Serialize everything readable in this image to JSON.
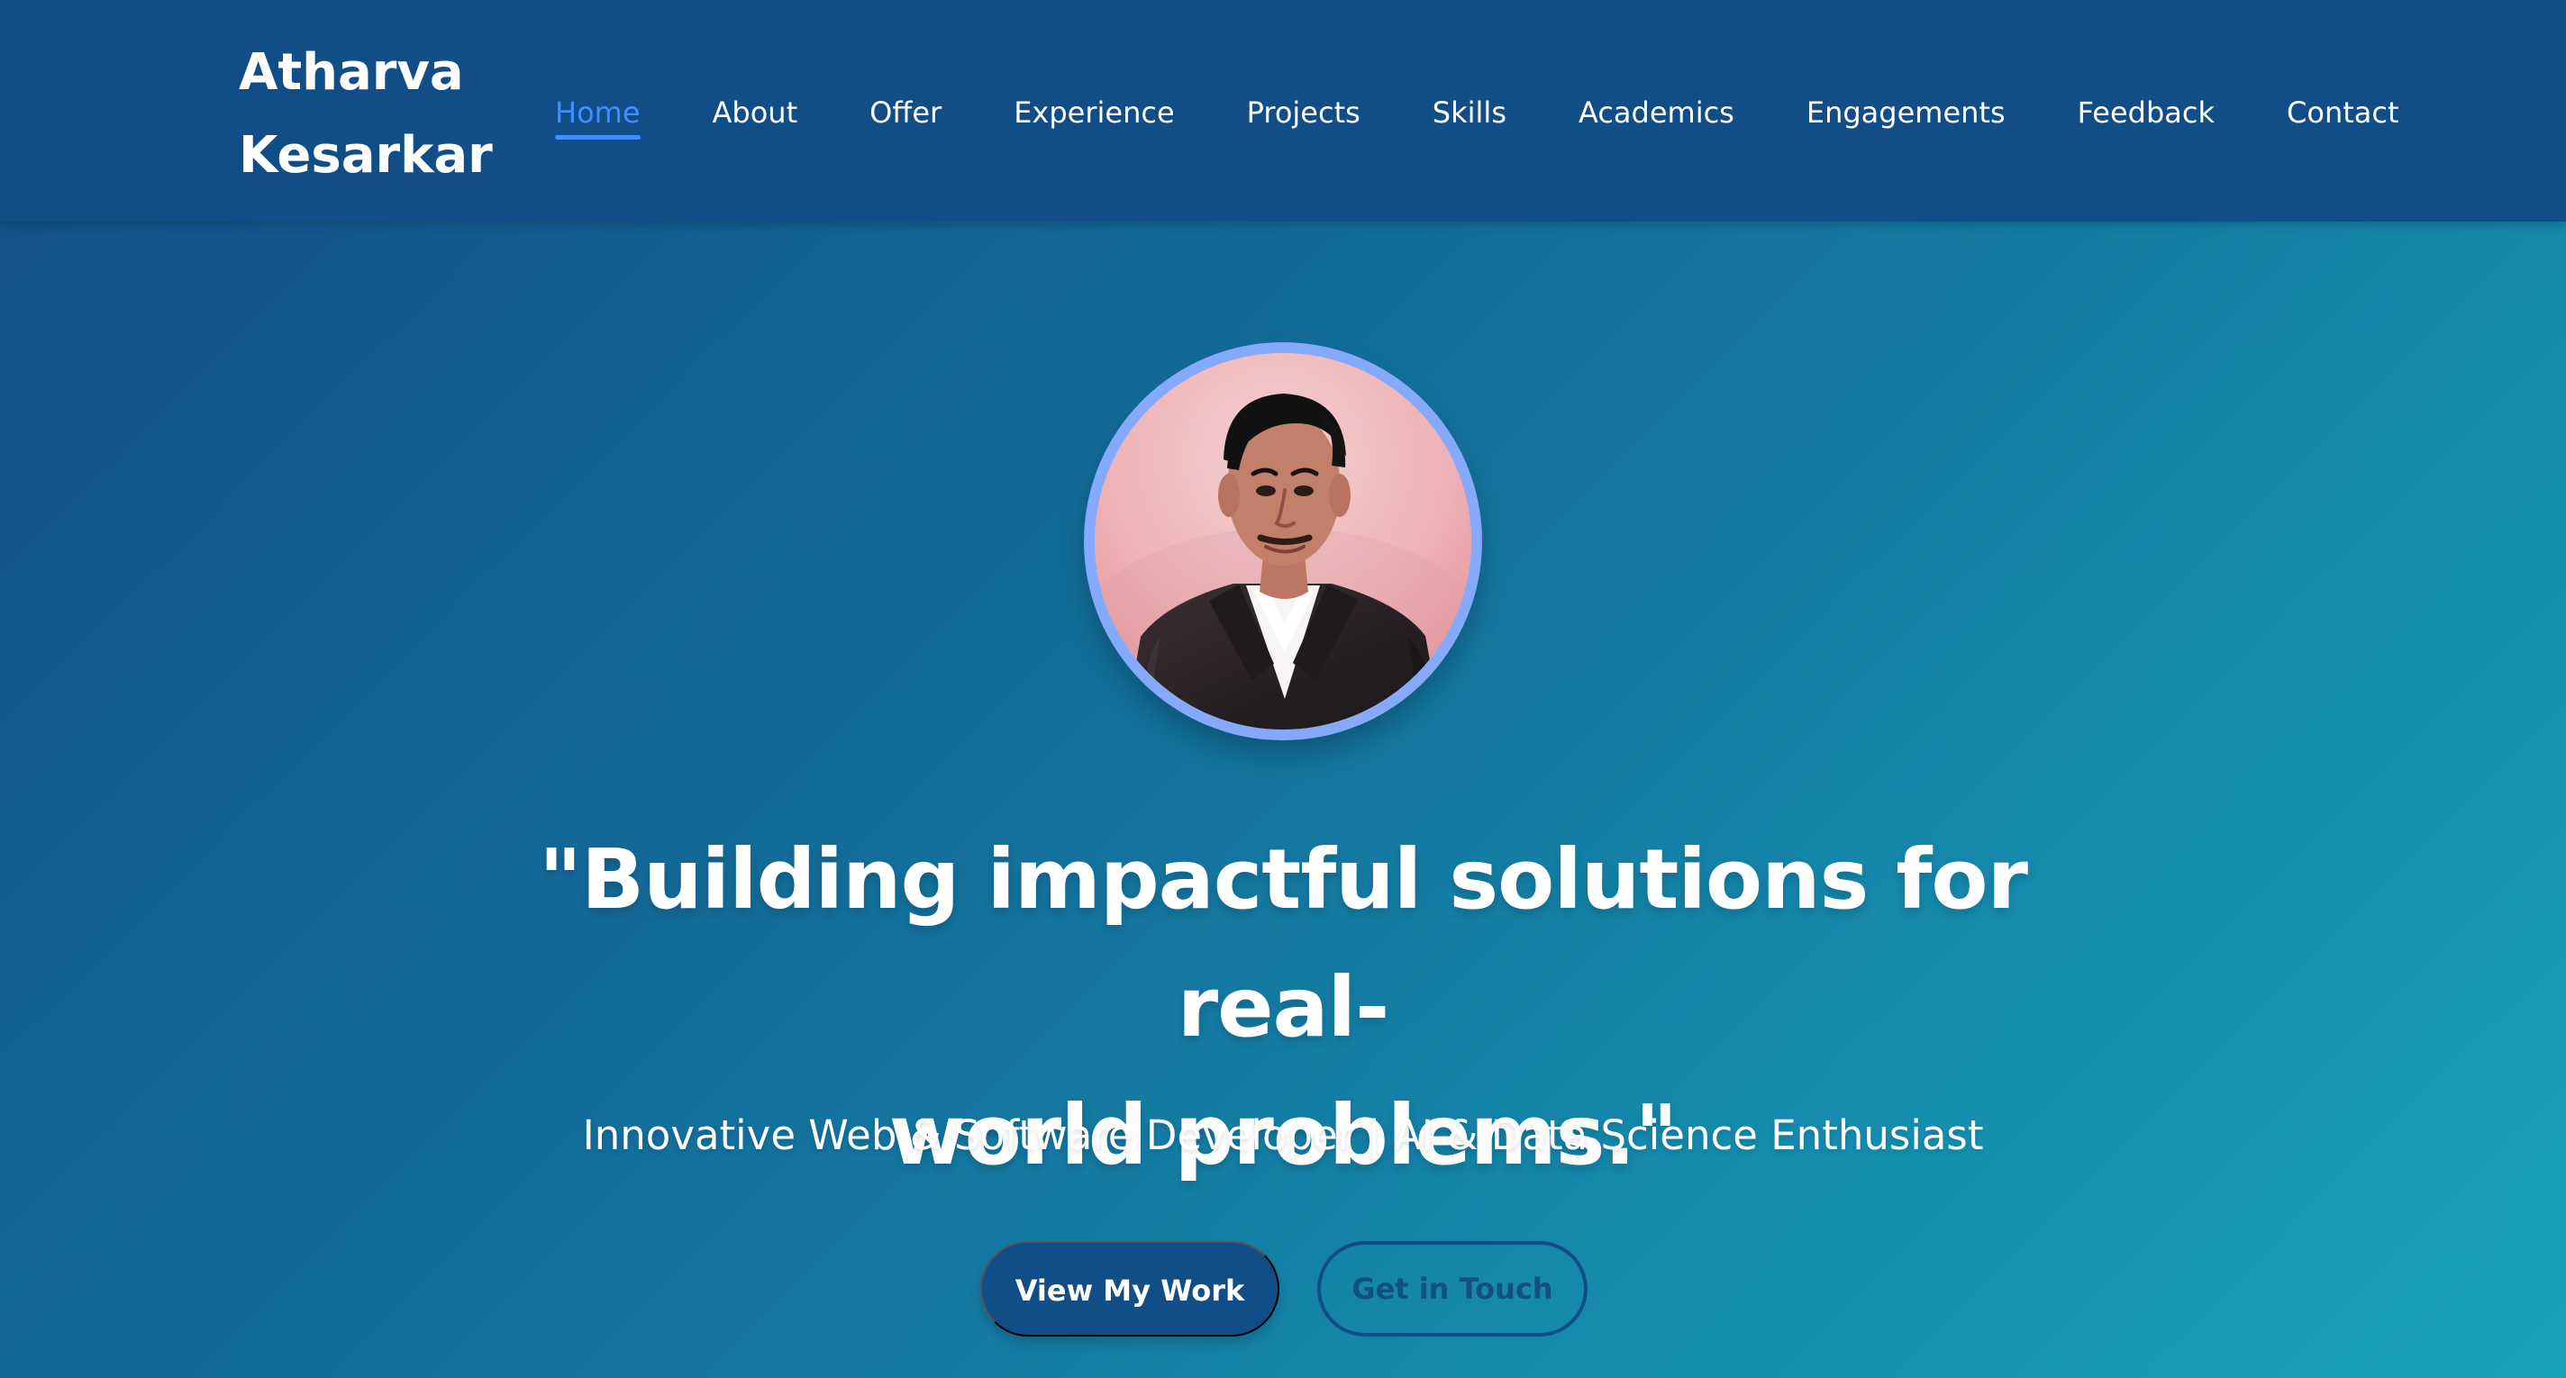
{
  "brand": {
    "line1": "Atharva",
    "line2": "Kesarkar"
  },
  "navigation": {
    "items": [
      {
        "label": "Home",
        "active": true
      },
      {
        "label": "About",
        "active": false
      },
      {
        "label": "Offer",
        "active": false
      },
      {
        "label": "Experience",
        "active": false
      },
      {
        "label": "Projects",
        "active": false
      },
      {
        "label": "Skills",
        "active": false
      },
      {
        "label": "Academics",
        "active": false
      },
      {
        "label": "Engagements",
        "active": false
      },
      {
        "label": "Feedback",
        "active": false
      },
      {
        "label": "Contact",
        "active": false
      }
    ]
  },
  "hero": {
    "headline_line1": "\"Building impactful solutions for real-",
    "headline_line2": "world problems.\"",
    "subtitle": "Innovative Web & Software Developer | AI & Data Science Enthusiast",
    "primary_button": "View My Work",
    "secondary_button": "Get in Touch"
  },
  "colors": {
    "navbar": "#114d86",
    "active_nav": "#3f8fff",
    "avatar_border": "#85aafb",
    "button_primary": "#114d86"
  },
  "icons": {
    "profile_photo": "profile-photo-avatar"
  }
}
